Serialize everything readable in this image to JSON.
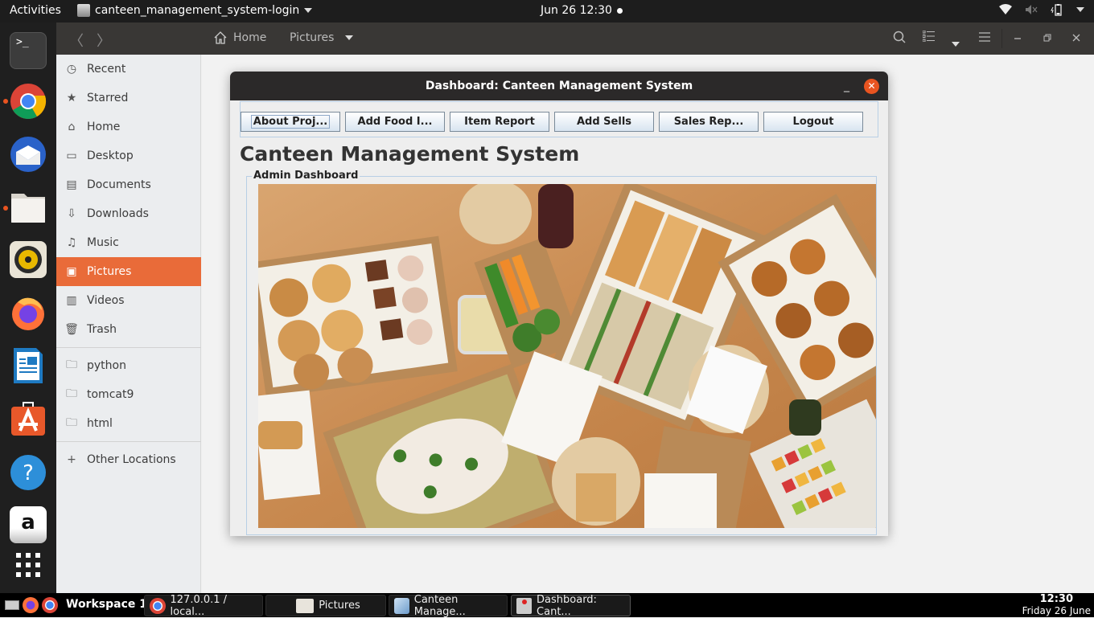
{
  "topbar": {
    "activities": "Activities",
    "app_name": "canteen_management_system-login",
    "clock": "Jun 26  12:30",
    "tray_icons": [
      "wifi-icon",
      "volume-muted-icon",
      "battery-icon",
      "system-menu-caret"
    ]
  },
  "dock": {
    "items": [
      {
        "name": "terminal",
        "icon": "terminal-icon",
        "running": false
      },
      {
        "name": "chrome",
        "icon": "chrome-icon",
        "running": true
      },
      {
        "name": "thunderbird",
        "icon": "thunderbird-icon",
        "running": false
      },
      {
        "name": "files",
        "icon": "files-icon",
        "running": true
      },
      {
        "name": "rhythmbox",
        "icon": "rhythmbox-icon",
        "running": false
      },
      {
        "name": "firefox",
        "icon": "firefox-icon",
        "running": false
      },
      {
        "name": "libreoffice-writer",
        "icon": "writer-icon",
        "running": false
      },
      {
        "name": "software",
        "icon": "software-icon",
        "running": false
      },
      {
        "name": "help",
        "icon": "help-icon",
        "running": false
      },
      {
        "name": "amazon",
        "icon": "amazon-icon",
        "running": false
      },
      {
        "name": "show-apps",
        "icon": "grid-icon",
        "running": false
      }
    ]
  },
  "file_manager": {
    "breadcrumb": {
      "home": "Home",
      "current": "Pictures"
    },
    "sidebar": {
      "places": [
        {
          "label": "Recent",
          "icon": "clock-icon"
        },
        {
          "label": "Starred",
          "icon": "star-icon"
        },
        {
          "label": "Home",
          "icon": "home-icon"
        },
        {
          "label": "Desktop",
          "icon": "desktop-icon"
        },
        {
          "label": "Documents",
          "icon": "document-icon"
        },
        {
          "label": "Downloads",
          "icon": "download-icon"
        },
        {
          "label": "Music",
          "icon": "music-icon"
        },
        {
          "label": "Pictures",
          "icon": "picture-icon",
          "active": true
        },
        {
          "label": "Videos",
          "icon": "film-icon"
        },
        {
          "label": "Trash",
          "icon": "trash-icon"
        }
      ],
      "bookmarks": [
        {
          "label": "python",
          "icon": "folder-icon"
        },
        {
          "label": "tomcat9",
          "icon": "folder-icon"
        },
        {
          "label": "html",
          "icon": "folder-icon"
        }
      ],
      "other": {
        "label": "Other Locations",
        "icon": "plus-icon"
      }
    }
  },
  "dashboard": {
    "window_title": "Dashboard: Canteen Management System",
    "buttons": [
      "About Proj...",
      "Add Food I...",
      "Item Report",
      "Add Sells",
      "Sales Rep...",
      "Logout"
    ],
    "heading": "Canteen Management System",
    "group_label": "Admin Dashboard",
    "image_alt": "Catering spread: cookies, brownies, sandwiches, pastries, salad, fruit skewers",
    "accent": "#e95420"
  },
  "taskbar": {
    "workspace": "Workspace 1",
    "tasks": [
      {
        "label": "127.0.0.1 / local...",
        "icon": "chrome-icon"
      },
      {
        "label": "Pictures",
        "icon": "folder-icon"
      },
      {
        "label": "Canteen Manage...",
        "icon": "cube-icon"
      },
      {
        "label": "Dashboard: Cant...",
        "icon": "java-icon",
        "active": true
      }
    ],
    "time": "12:30",
    "date": "Friday 26 June"
  }
}
